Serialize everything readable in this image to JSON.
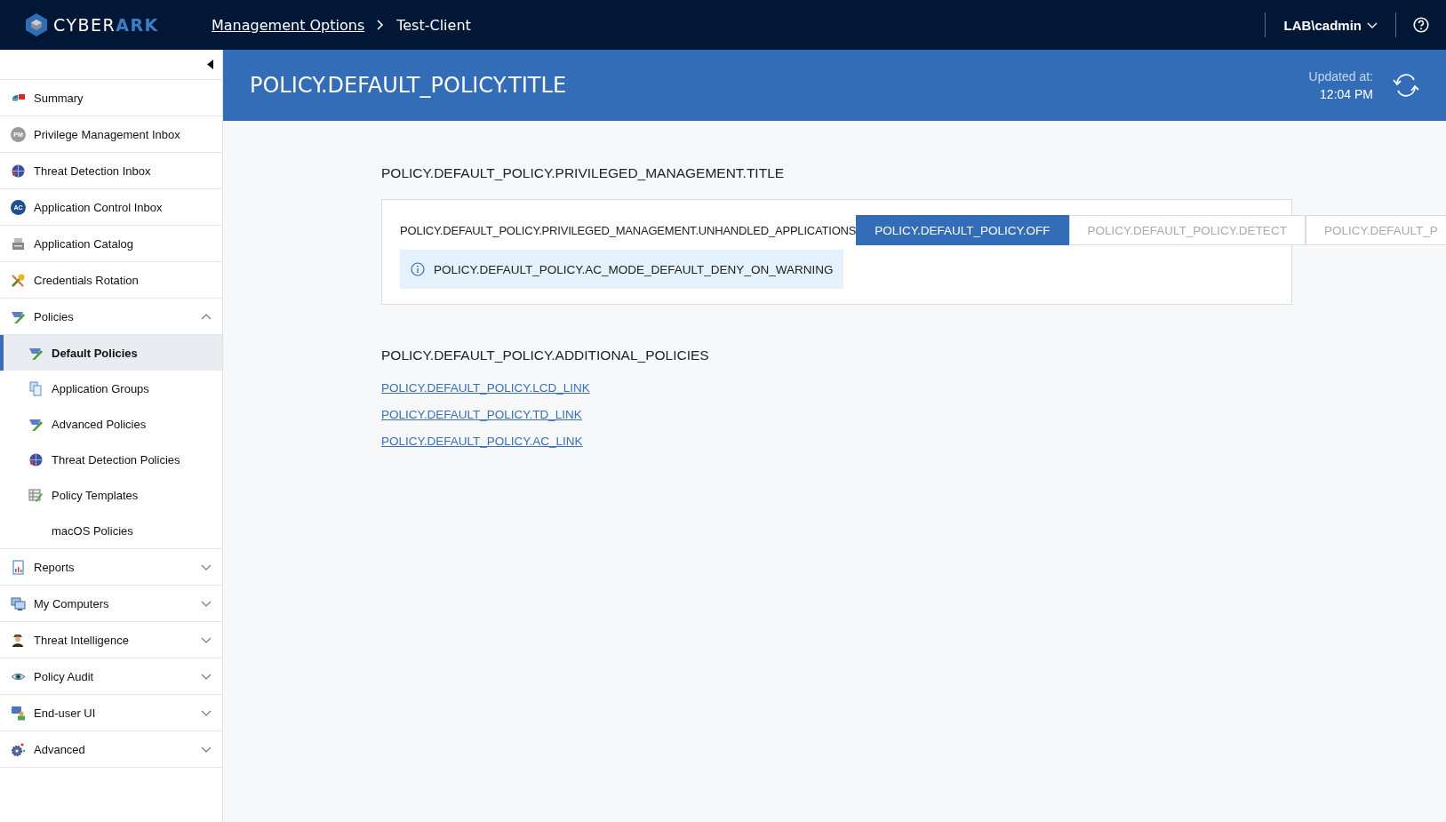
{
  "header": {
    "logo": {
      "prefix": "CYBER",
      "suffix": "ARK"
    },
    "breadcrumb": [
      "Management Options",
      "Test-Client"
    ],
    "user": "LAB\\cadmin"
  },
  "sidebar": {
    "items": [
      {
        "label": "Summary",
        "selected": false
      },
      {
        "label": "Privilege Management Inbox",
        "badge": "PM",
        "selected": false
      },
      {
        "label": "Threat Detection Inbox",
        "selected": false
      },
      {
        "label": "Application Control Inbox",
        "badge": "AC",
        "selected": false
      },
      {
        "label": "Application Catalog",
        "selected": false
      },
      {
        "label": "Credentials Rotation",
        "selected": false
      },
      {
        "label": "Policies",
        "selected": false,
        "expanded": true,
        "children": [
          {
            "label": "Default Policies",
            "selected": true
          },
          {
            "label": "Application Groups",
            "selected": false
          },
          {
            "label": "Advanced Policies",
            "selected": false
          },
          {
            "label": "Threat Detection Policies",
            "selected": false
          },
          {
            "label": "Policy Templates",
            "selected": false
          },
          {
            "label": "macOS Policies",
            "selected": false
          }
        ]
      },
      {
        "label": "Reports",
        "selected": false,
        "expanded": false
      },
      {
        "label": "My Computers",
        "selected": false,
        "expanded": false
      },
      {
        "label": "Threat Intelligence",
        "selected": false,
        "expanded": false
      },
      {
        "label": "Policy Audit",
        "selected": false,
        "expanded": false
      },
      {
        "label": "End-user UI",
        "selected": false,
        "expanded": false
      },
      {
        "label": "Advanced",
        "selected": false,
        "expanded": false
      }
    ]
  },
  "banner": {
    "title": "POLICY.DEFAULT_POLICY.TITLE",
    "updated_label": "Updated at:",
    "updated_time": "12:04 PM"
  },
  "privileged_section": {
    "title": "POLICY.DEFAULT_POLICY.PRIVILEGED_MANAGEMENT.TITLE",
    "label": "POLICY.DEFAULT_POLICY.PRIVILEGED_MANAGEMENT.UNHANDLED_APPLICATIONS",
    "options": [
      {
        "label": "POLICY.DEFAULT_POLICY.OFF",
        "selected": true
      },
      {
        "label": "POLICY.DEFAULT_POLICY.DETECT",
        "selected": false
      },
      {
        "label": "POLICY.DEFAULT_P",
        "selected": false
      }
    ],
    "info": "POLICY.DEFAULT_POLICY.AC_MODE_DEFAULT_DENY_ON_WARNING"
  },
  "additional_section": {
    "title": "POLICY.DEFAULT_POLICY.ADDITIONAL_POLICIES",
    "links": [
      "POLICY.DEFAULT_POLICY.LCD_LINK",
      "POLICY.DEFAULT_POLICY.TD_LINK",
      "POLICY.DEFAULT_POLICY.AC_LINK"
    ]
  }
}
